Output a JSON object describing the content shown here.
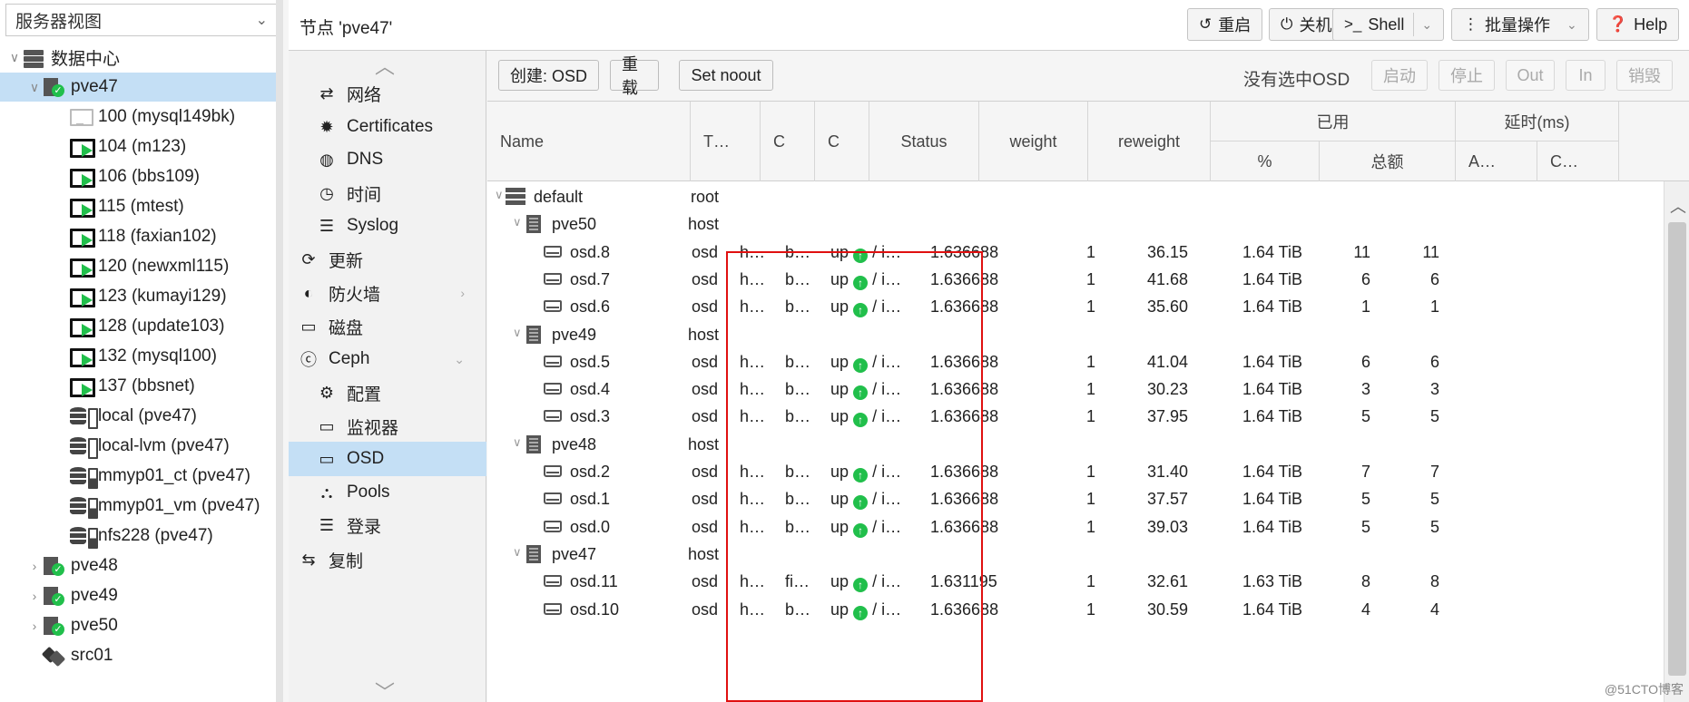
{
  "left_panel": {
    "view_select": "服务器视图",
    "tree": [
      {
        "label": "数据中心",
        "icon": "datacenter-icon"
      },
      {
        "label": "pve47",
        "icon": "node-online-icon"
      },
      {
        "label": "100 (mysql149bk)",
        "icon": "vm-stopped-icon"
      },
      {
        "label": "104 (m123)",
        "icon": "vm-running-icon"
      },
      {
        "label": "106 (bbs109)",
        "icon": "vm-running-icon"
      },
      {
        "label": "115 (mtest)",
        "icon": "vm-running-icon"
      },
      {
        "label": "118 (faxian102)",
        "icon": "vm-running-icon"
      },
      {
        "label": "120 (newxml115)",
        "icon": "vm-running-icon"
      },
      {
        "label": "123 (kumayi129)",
        "icon": "vm-running-icon"
      },
      {
        "label": "128 (update103)",
        "icon": "vm-running-icon"
      },
      {
        "label": "132 (mysql100)",
        "icon": "vm-running-icon"
      },
      {
        "label": "137 (bbsnet)",
        "icon": "vm-running-icon"
      },
      {
        "label": "local (pve47)",
        "icon": "storage-icon"
      },
      {
        "label": "local-lvm (pve47)",
        "icon": "storage-icon"
      },
      {
        "label": "mmyp01_ct (pve47)",
        "icon": "storage-active-icon"
      },
      {
        "label": "mmyp01_vm (pve47)",
        "icon": "storage-active-icon"
      },
      {
        "label": "nfs228 (pve47)",
        "icon": "storage-active-icon"
      },
      {
        "label": "pve48",
        "icon": "node-online-icon"
      },
      {
        "label": "pve49",
        "icon": "node-online-icon"
      },
      {
        "label": "pve50",
        "icon": "node-online-icon"
      },
      {
        "label": "src01",
        "icon": "tag-icon"
      }
    ]
  },
  "header": {
    "title": "节点 'pve47'",
    "buttons": {
      "reboot": "重启",
      "shutdown": "关机",
      "shell": "Shell",
      "bulk": "批量操作",
      "help": "Help"
    }
  },
  "nav": {
    "items": [
      {
        "label": "网络",
        "icon": "network-icon"
      },
      {
        "label": "Certificates",
        "icon": "certificate-icon"
      },
      {
        "label": "DNS",
        "icon": "globe-icon"
      },
      {
        "label": "时间",
        "icon": "clock-icon"
      },
      {
        "label": "Syslog",
        "icon": "list-icon"
      },
      {
        "label": "更新",
        "icon": "refresh-icon"
      },
      {
        "label": "防火墙",
        "icon": "shield-icon"
      },
      {
        "label": "磁盘",
        "icon": "disk-icon"
      },
      {
        "label": "Ceph",
        "icon": "ceph-icon"
      },
      {
        "label": "配置",
        "icon": "gear-icon"
      },
      {
        "label": "监视器",
        "icon": "monitor-icon"
      },
      {
        "label": "OSD",
        "icon": "disk-icon"
      },
      {
        "label": "Pools",
        "icon": "sitemap-icon"
      },
      {
        "label": "登录",
        "icon": "list-icon"
      },
      {
        "label": "复制",
        "icon": "retweet-icon"
      }
    ]
  },
  "toolbar": {
    "create": "创建: OSD",
    "reload": "重载",
    "set_noout": "Set noout",
    "no_selection": "没有选中OSD",
    "start": "启动",
    "stop": "停止",
    "out": "Out",
    "in": "In",
    "destroy": "销毁"
  },
  "grid": {
    "headers": {
      "name": "Name",
      "type": "T…",
      "c1": "C",
      "c2": "C",
      "status": "Status",
      "weight": "weight",
      "reweight": "reweight",
      "used": "已用",
      "used_pct": "%",
      "used_total": "总额",
      "latency": "延时(ms)",
      "lat_a": "A…",
      "lat_c": "C…"
    },
    "rows": [
      {
        "kind": "root",
        "name": "default",
        "type": "root"
      },
      {
        "kind": "host",
        "name": "pve50",
        "type": "host"
      },
      {
        "kind": "osd",
        "name": "osd.8",
        "type": "osd",
        "c1": "h…",
        "c2": "b…",
        "status": "up",
        "status_suffix": "/ i…",
        "weight": "1.636688",
        "reweight": "1",
        "pct": "36.15",
        "total": "1.64 TiB",
        "a": "11",
        "c": "11"
      },
      {
        "kind": "osd",
        "name": "osd.7",
        "type": "osd",
        "c1": "h…",
        "c2": "b…",
        "status": "up",
        "status_suffix": "/ i…",
        "weight": "1.636688",
        "reweight": "1",
        "pct": "41.68",
        "total": "1.64 TiB",
        "a": "6",
        "c": "6"
      },
      {
        "kind": "osd",
        "name": "osd.6",
        "type": "osd",
        "c1": "h…",
        "c2": "b…",
        "status": "up",
        "status_suffix": "/ i…",
        "weight": "1.636688",
        "reweight": "1",
        "pct": "35.60",
        "total": "1.64 TiB",
        "a": "1",
        "c": "1"
      },
      {
        "kind": "host",
        "name": "pve49",
        "type": "host"
      },
      {
        "kind": "osd",
        "name": "osd.5",
        "type": "osd",
        "c1": "h…",
        "c2": "b…",
        "status": "up",
        "status_suffix": "/ i…",
        "weight": "1.636688",
        "reweight": "1",
        "pct": "41.04",
        "total": "1.64 TiB",
        "a": "6",
        "c": "6"
      },
      {
        "kind": "osd",
        "name": "osd.4",
        "type": "osd",
        "c1": "h…",
        "c2": "b…",
        "status": "up",
        "status_suffix": "/ i…",
        "weight": "1.636688",
        "reweight": "1",
        "pct": "30.23",
        "total": "1.64 TiB",
        "a": "3",
        "c": "3"
      },
      {
        "kind": "osd",
        "name": "osd.3",
        "type": "osd",
        "c1": "h…",
        "c2": "b…",
        "status": "up",
        "status_suffix": "/ i…",
        "weight": "1.636688",
        "reweight": "1",
        "pct": "37.95",
        "total": "1.64 TiB",
        "a": "5",
        "c": "5"
      },
      {
        "kind": "host",
        "name": "pve48",
        "type": "host"
      },
      {
        "kind": "osd",
        "name": "osd.2",
        "type": "osd",
        "c1": "h…",
        "c2": "b…",
        "status": "up",
        "status_suffix": "/ i…",
        "weight": "1.636688",
        "reweight": "1",
        "pct": "31.40",
        "total": "1.64 TiB",
        "a": "7",
        "c": "7"
      },
      {
        "kind": "osd",
        "name": "osd.1",
        "type": "osd",
        "c1": "h…",
        "c2": "b…",
        "status": "up",
        "status_suffix": "/ i…",
        "weight": "1.636688",
        "reweight": "1",
        "pct": "37.57",
        "total": "1.64 TiB",
        "a": "5",
        "c": "5"
      },
      {
        "kind": "osd",
        "name": "osd.0",
        "type": "osd",
        "c1": "h…",
        "c2": "b…",
        "status": "up",
        "status_suffix": "/ i…",
        "weight": "1.636688",
        "reweight": "1",
        "pct": "39.03",
        "total": "1.64 TiB",
        "a": "5",
        "c": "5"
      },
      {
        "kind": "host",
        "name": "pve47",
        "type": "host"
      },
      {
        "kind": "osd",
        "name": "osd.11",
        "type": "osd",
        "c1": "h…",
        "c2": "fi…",
        "status": "up",
        "status_suffix": "/ i…",
        "weight": "1.631195",
        "reweight": "1",
        "pct": "32.61",
        "total": "1.63 TiB",
        "a": "8",
        "c": "8"
      },
      {
        "kind": "osd",
        "name": "osd.10",
        "type": "osd",
        "c1": "h…",
        "c2": "b…",
        "status": "up",
        "status_suffix": "/ i…",
        "weight": "1.636688",
        "reweight": "1",
        "pct": "30.59",
        "total": "1.64 TiB",
        "a": "4",
        "c": "4"
      }
    ]
  },
  "watermark": "@51CTO博客",
  "colors": {
    "selection": "#c4dff5",
    "status_up": "#21bf4b",
    "highlight_box": "#e01010"
  }
}
